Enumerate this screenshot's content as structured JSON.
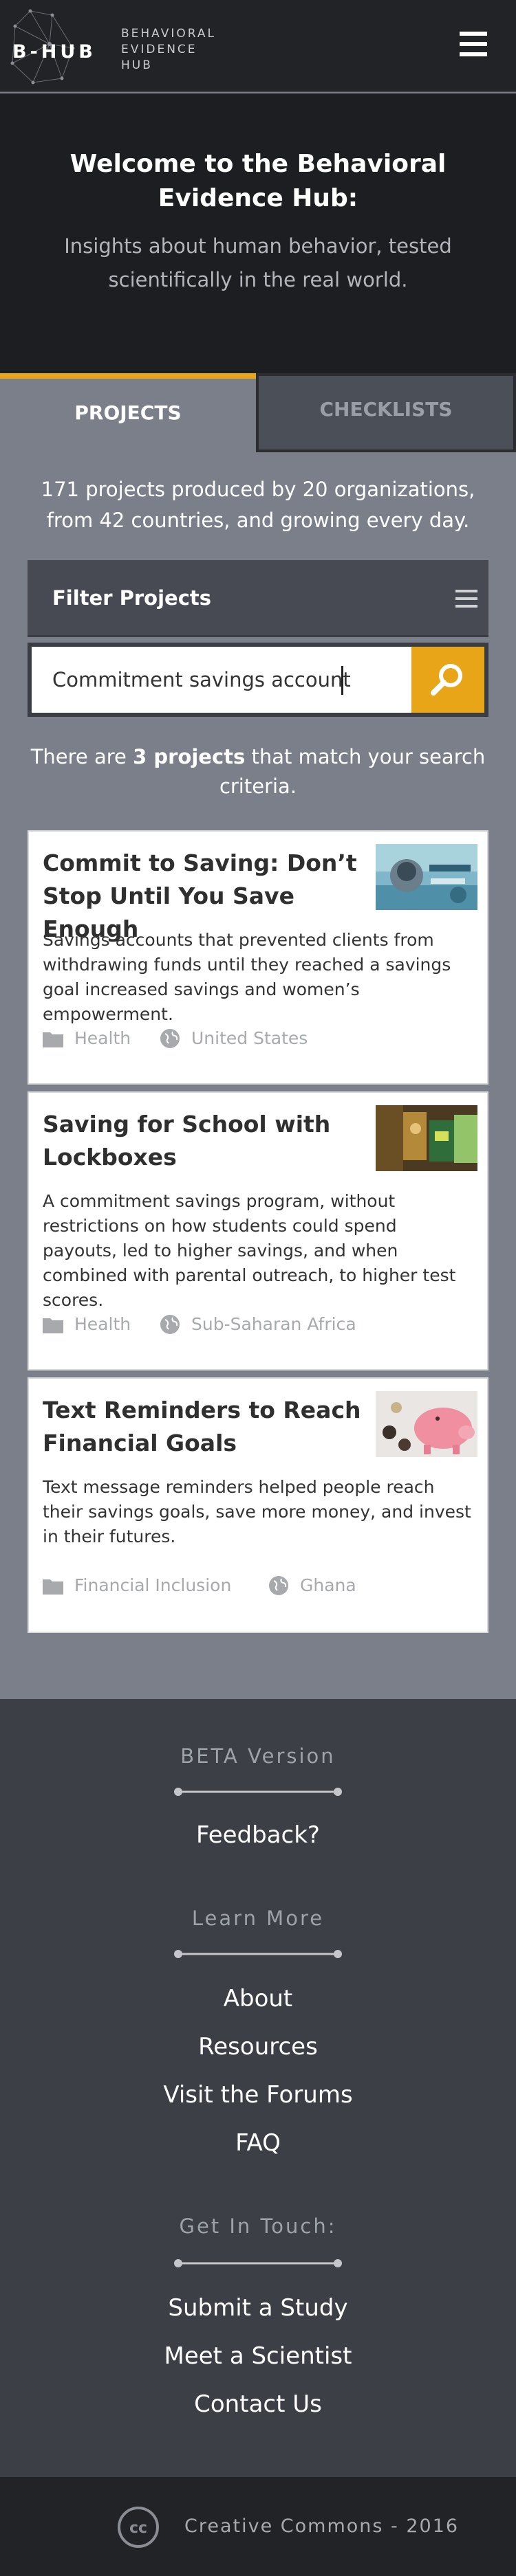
{
  "header": {
    "logo_text": "B-HUB",
    "logo_subtitle": [
      "BEHAVIORAL",
      "EVIDENCE",
      "HUB"
    ]
  },
  "hero": {
    "title": "Welcome to the Behavioral Evidence Hub:",
    "subtitle": "Insights about human behavior, tested scientifically in the real world."
  },
  "tabs": [
    {
      "label": "PROJECTS",
      "active": true
    },
    {
      "label": "CHECKLISTS",
      "active": false
    }
  ],
  "projects": {
    "intro": "171 projects produced by 20 organizations, from 42 countries, and growing every day.",
    "filter_label": "Filter Projects",
    "search_value": "Commitment savings account",
    "match_prefix": "There are ",
    "match_count": "3 projects",
    "match_suffix": " that match your search criteria."
  },
  "cards": [
    {
      "title": "Commit to Saving: Don’t Stop Until You Save Enough",
      "description": "Savings accounts that prevented clients from withdrawing funds until they reached a savings goal increased savings and women’s empowerment.",
      "topic": "Health",
      "region": "United States"
    },
    {
      "title": "Saving for School with Lockboxes",
      "description": "A commitment savings program, without restrictions on how students could spend payouts, led to higher savings, and when combined with parental outreach, to higher test scores.",
      "topic": "Health",
      "region": "Sub-Saharan Africa"
    },
    {
      "title": "Text Reminders to Reach Financial Goals",
      "description": "Text message reminders helped people reach their savings goals, save more money, and invest in their futures.",
      "topic": "Financial Inclusion",
      "region": "Ghana"
    }
  ],
  "footer": {
    "beta_heading": "BETA Version",
    "feedback": "Feedback?",
    "learn_heading": "Learn More",
    "learn_links": [
      "About",
      "Resources",
      "Visit the Forums",
      "FAQ"
    ],
    "touch_heading": "Get In Touch:",
    "touch_links": [
      "Submit a Study",
      "Meet a Scientist",
      "Contact Us"
    ],
    "copyright": "Creative Commons - 2016"
  },
  "colors": {
    "accent": "#e8a518",
    "header_bg": "#222326",
    "page_bg": "#7a7f8a",
    "footer_bg": "#3c3f46"
  }
}
